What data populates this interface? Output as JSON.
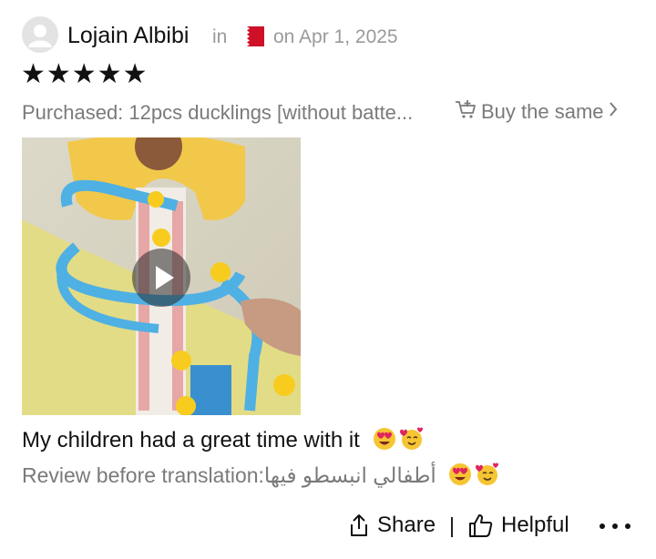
{
  "review": {
    "reviewer_name": "Lojain Albibi",
    "in_label": "in",
    "country_flag_icon": "bahrain-flag-icon",
    "date": "on Apr 1, 2025",
    "rating": 5,
    "stars_text": "★★★★★",
    "purchased": "Purchased: 12pcs ducklings [without batte...",
    "buy_same_label": "Buy the same",
    "media_type": "video",
    "text": "My children had a great time with it",
    "original_prefix": "Review before translation:",
    "original_text": "أطفالي انبسطو فيها"
  },
  "actions": {
    "share_label": "Share",
    "helpful_label": "Helpful"
  },
  "colors": {
    "muted": "#7a7a7a",
    "flag_red": "#ce1126"
  }
}
